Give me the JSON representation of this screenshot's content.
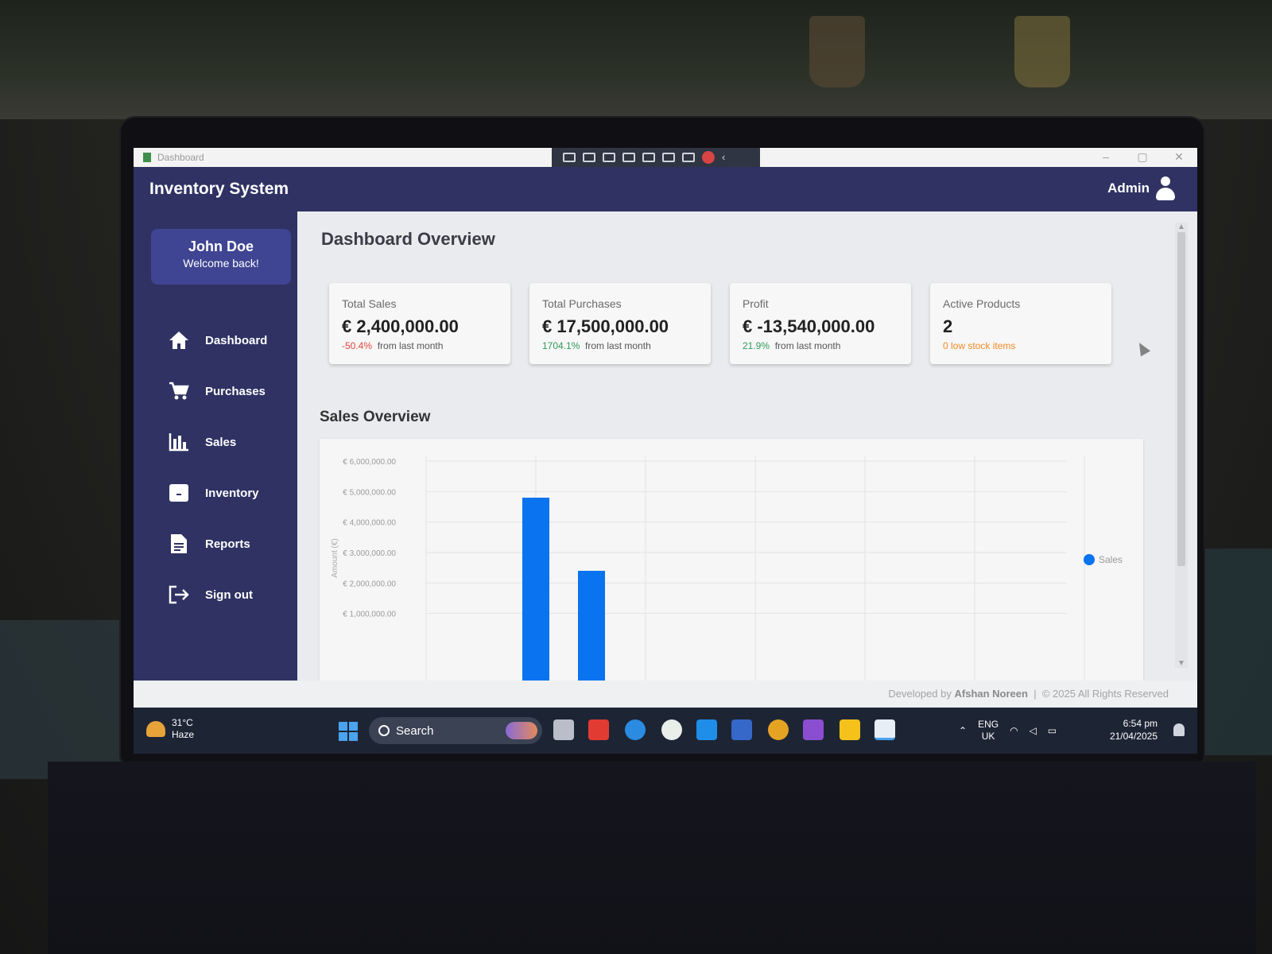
{
  "window": {
    "title": "Dashboard",
    "controls": [
      "–",
      "▢",
      "✕"
    ]
  },
  "app": {
    "title": "Inventory System",
    "user_label": "Admin"
  },
  "user_card": {
    "name": "John Doe",
    "greeting": "Welcome back!"
  },
  "sidebar": {
    "items": [
      {
        "label": "Dashboard",
        "icon": "home-icon"
      },
      {
        "label": "Purchases",
        "icon": "cart-icon"
      },
      {
        "label": "Sales",
        "icon": "bar-chart-icon"
      },
      {
        "label": "Inventory",
        "icon": "box-icon"
      },
      {
        "label": "Reports",
        "icon": "document-icon"
      },
      {
        "label": "Sign out",
        "icon": "sign-out-icon"
      }
    ]
  },
  "main": {
    "title": "Dashboard Overview",
    "cards": [
      {
        "label": "Total Sales",
        "value": "€ 2,400,000.00",
        "change": "-50.4%",
        "change_status": "negative",
        "suffix": "from last month"
      },
      {
        "label": "Total Purchases",
        "value": "€ 17,500,000.00",
        "change": "1704.1%",
        "change_status": "positive",
        "suffix": "from last month"
      },
      {
        "label": "Profit",
        "value": "€ -13,540,000.00",
        "change": "21.9%",
        "change_status": "positive",
        "suffix": "from last month"
      },
      {
        "label": "Active Products",
        "value": "2",
        "note": "0 low stock items"
      }
    ],
    "section_title": "Sales Overview"
  },
  "chart_data": {
    "type": "bar",
    "ylabel": "Amount (€)",
    "y_ticks": [
      "€ 6,000,000.00",
      "€ 5,000,000.00",
      "€ 4,000,000.00",
      "€ 3,000,000.00",
      "€ 2,000,000.00",
      "€ 1,000,000.00"
    ],
    "ylim": [
      0,
      6000000
    ],
    "visible_ylim": [
      500000,
      6000000
    ],
    "series": [
      {
        "name": "Sales",
        "values": [
          4800000,
          2400000
        ]
      }
    ],
    "legend_position": "right",
    "grid": true,
    "colors": {
      "bar": "#0a73ef",
      "legend_dot": "#0a73ef"
    }
  },
  "footer": {
    "prefix": "Developed by",
    "author": "Afshan Noreen",
    "separator": "|",
    "copyright": "© 2025 All Rights Reserved"
  },
  "taskbar": {
    "weather_temp": "31°C",
    "weather_desc": "Haze",
    "search_label": "Search",
    "lang_top": "ENG",
    "lang_bottom": "UK",
    "time": "6:54 pm",
    "date": "21/04/2025"
  },
  "colors": {
    "header": "#2f3263",
    "user_card": "#3f4592",
    "negative": "#e0453d",
    "positive": "#2e9b58",
    "warning": "#f08a24"
  }
}
